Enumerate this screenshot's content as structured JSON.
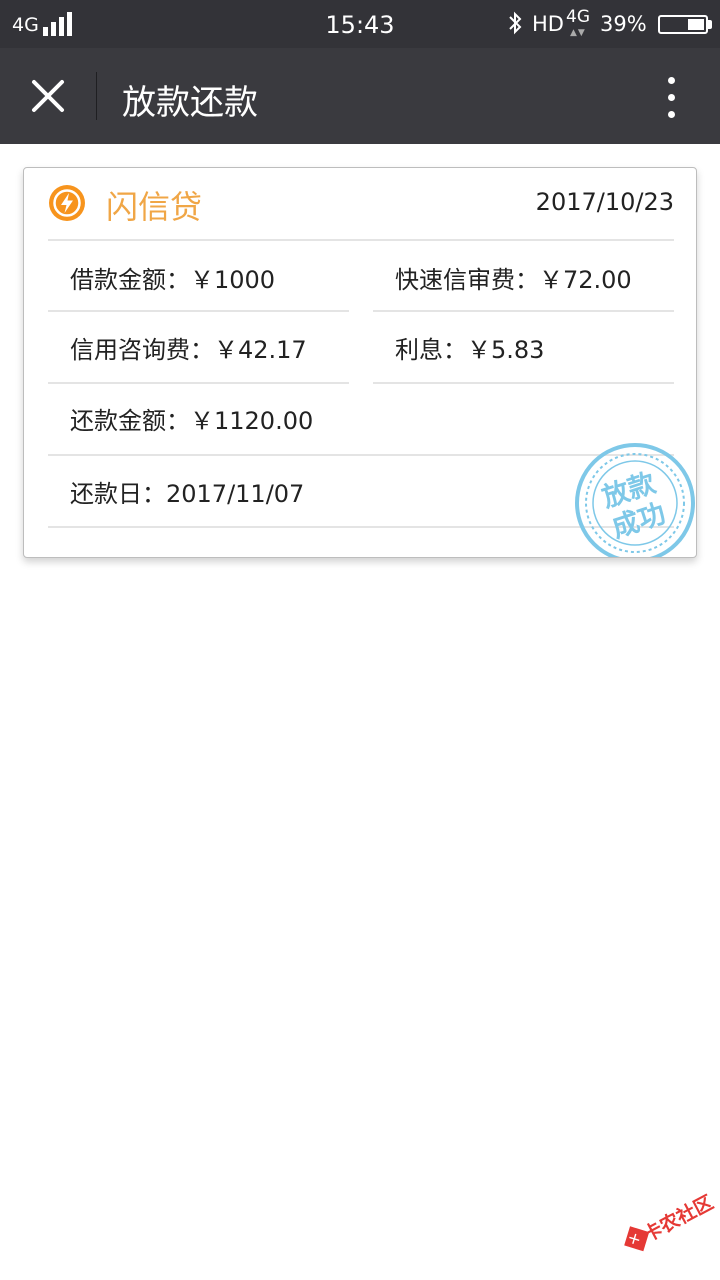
{
  "status_bar": {
    "network_left": "4G",
    "time": "15:43",
    "hd": "HD",
    "network_right": "4G",
    "battery_percent": "39%",
    "battery_level": 0.39
  },
  "nav": {
    "title": "放款还款"
  },
  "card": {
    "brand": "闪信贷",
    "date": "2017/10/23",
    "loan_amount": "借款金额：￥1000",
    "fast_review_fee": "快速信审费：￥72.00",
    "credit_consult_fee": "信用咨询费：￥42.17",
    "interest": "利息：￥5.83",
    "repay_amount": "还款金额：￥1120.00",
    "repay_date": "还款日：2017/11/07",
    "stamp_text": "放款成功"
  },
  "watermark": {
    "text": "卡农社区"
  },
  "colors": {
    "status_bar": "#333338",
    "nav_bar": "#3a3a3f",
    "brand": "#f0a646",
    "stamp": "#7ec8e8",
    "watermark": "#e53935"
  },
  "icons": {
    "close": "close-icon",
    "more": "more-vertical-icon",
    "brand": "lightning-icon",
    "bluetooth": "bluetooth-icon",
    "signal": "signal-icon",
    "battery": "battery-icon"
  }
}
